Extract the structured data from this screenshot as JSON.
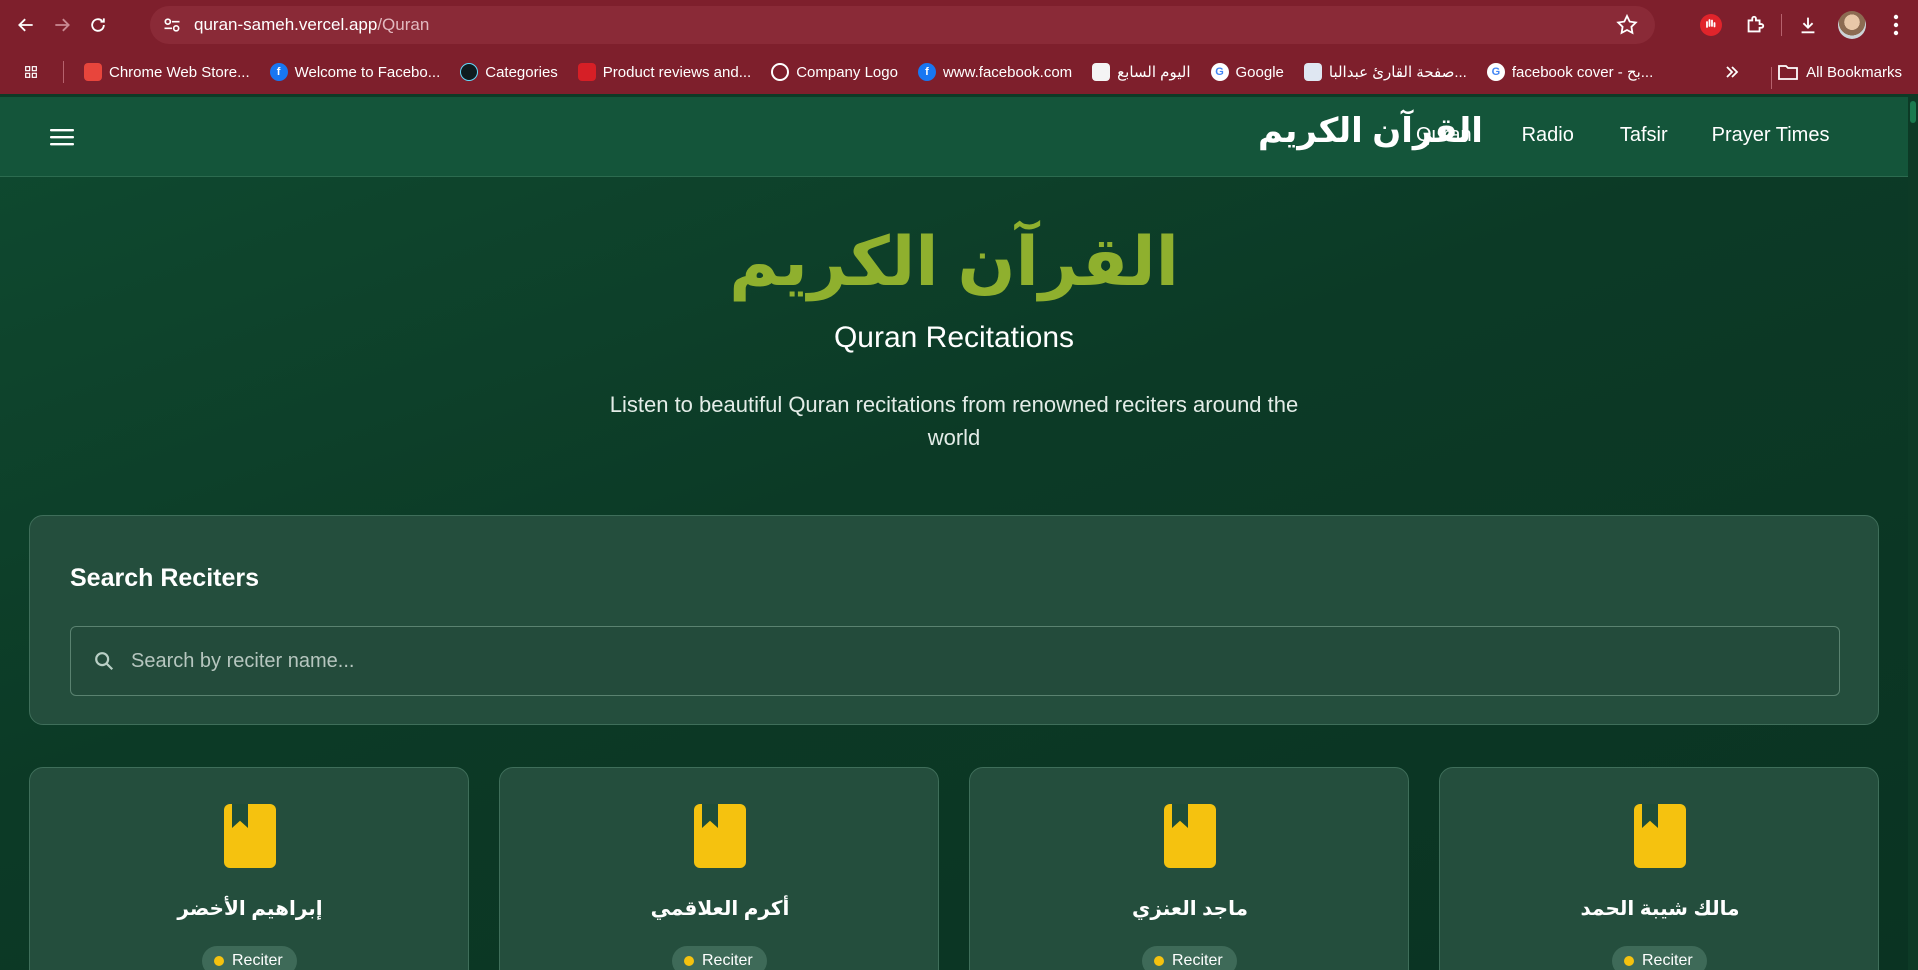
{
  "browser": {
    "url_host": "quran-sameh.vercel.app",
    "url_path": "/Quran",
    "bookmarks": [
      {
        "label": "Chrome Web Store...",
        "icon": "chrome-web-store-icon",
        "color": "#e8453c"
      },
      {
        "label": "Welcome to Facebo...",
        "icon": "facebook-icon",
        "color": "#1877f2"
      },
      {
        "label": "Categories",
        "icon": "react-icon",
        "color": "#0e1b1f"
      },
      {
        "label": "Product reviews and...",
        "icon": "red-square-icon",
        "color": "#d61f26"
      },
      {
        "label": "Company Logo",
        "icon": "globe-icon",
        "color": "#ffffff"
      },
      {
        "label": "www.facebook.com",
        "icon": "facebook-icon",
        "color": "#1877f2"
      },
      {
        "label": "اليوم السابع",
        "icon": "youm7-icon",
        "color": "#f4f4f4"
      },
      {
        "label": "Google",
        "icon": "google-icon",
        "color": "#ffffff"
      },
      {
        "label": "صفحة القارئ عبدالبا...",
        "icon": "reciter-page-icon",
        "color": "#dfe7f2"
      },
      {
        "label": "facebook cover - بح...",
        "icon": "google-icon",
        "color": "#ffffff"
      }
    ],
    "all_bookmarks_label": "All Bookmarks"
  },
  "header": {
    "brand": "القرآن الكريم",
    "nav": [
      "Quran",
      "Radio",
      "Tafsir",
      "Prayer Times"
    ]
  },
  "hero": {
    "title": "القرآن الكريم",
    "subtitle": "Quran Recitations",
    "description": "Listen to beautiful Quran recitations from renowned reciters around the world"
  },
  "search": {
    "title": "Search Reciters",
    "placeholder": "Search by reciter name..."
  },
  "reciters": [
    {
      "name": "إبراهيم الأخضر",
      "badge": "Reciter"
    },
    {
      "name": "أكرم العلاقمي",
      "badge": "Reciter"
    },
    {
      "name": "ماجد العنزي",
      "badge": "Reciter"
    },
    {
      "name": "مالك شيبة الحمد",
      "badge": "Reciter"
    }
  ],
  "colors": {
    "chrome": "#7e1f2c",
    "header": "#14553a",
    "accent_title": "#8fb02e",
    "icon_yellow": "#f5c20f",
    "card": "#244e3d"
  }
}
